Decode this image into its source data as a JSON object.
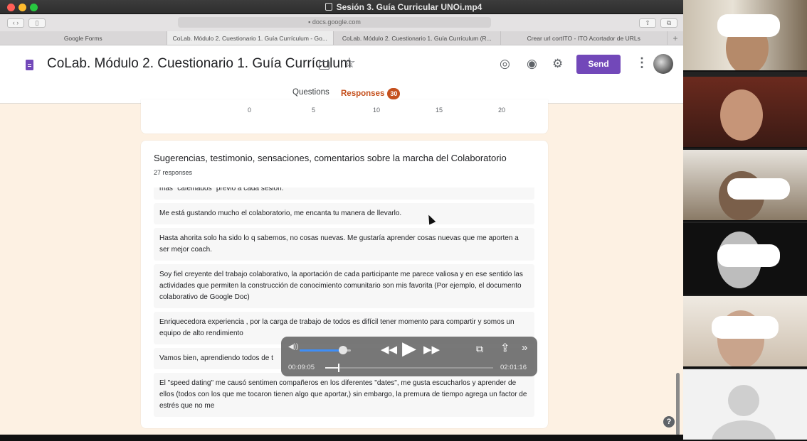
{
  "window": {
    "title": "Sesión 3. Guía Curricular UNOi.mp4"
  },
  "browser": {
    "url": "docs.google.com",
    "tabs": [
      {
        "label": "Google Forms"
      },
      {
        "label": "CoLab. Módulo 2. Cuestionario 1. Guía Currículum - Go..."
      },
      {
        "label": "CoLab. Módulo 2. Cuestionario 1. Guía Currículum (R..."
      },
      {
        "label": "Crear url cortITO - ITO Acortador de URLs"
      }
    ],
    "new_tab": "+"
  },
  "form": {
    "title": "CoLab. Módulo 2. Cuestionario 1. Guía Currículum",
    "send_label": "Send",
    "tabs": {
      "questions": "Questions",
      "responses": "Responses",
      "responses_count": "30"
    }
  },
  "chart_card": {
    "axis_ticks": [
      "0",
      "5",
      "10",
      "15",
      "20"
    ]
  },
  "question": {
    "title": "Sugerencias, testimonio, sensaciones, comentarios sobre la marcha del Colaboratorio",
    "count": "27 responses",
    "responses": [
      "mas \"cafeinados\" previo a cada sesión.",
      "Me está gustando mucho el colaboratorio, me encanta tu manera de llevarlo.",
      "Hasta ahorita solo ha sido lo q sabemos, no cosas nuevas. Me gustaría aprender cosas nuevas que me aporten a ser mejor coach.",
      "Soy fiel creyente del trabajo colaborativo, la aportación de cada participante me parece valiosa y en ese sentido las actividades que permiten la construcción de conocimiento comunitario son mis favorita (Por ejemplo, el documento colaborativo de Google Doc)",
      "Enriquecedora experiencia , por la carga de trabajo de todos es difícil tener momento para compartir y somos un equipo de alto rendimiento",
      "Vamos bien, aprendiendo todos de t",
      "El \"speed dating\" me causó sentimen compañeros en los diferentes \"dates\", me gusta escucharlos y aprender de ellos (todos con los que me tocaron tienen algo que aportar,) sin embargo, la premura de tiempo agrega un factor de estrés que no me"
    ]
  },
  "player": {
    "elapsed": "00:09:05",
    "total": "02:01:16",
    "volume": 0.85,
    "progress": 0.075
  },
  "help_label": "?"
}
